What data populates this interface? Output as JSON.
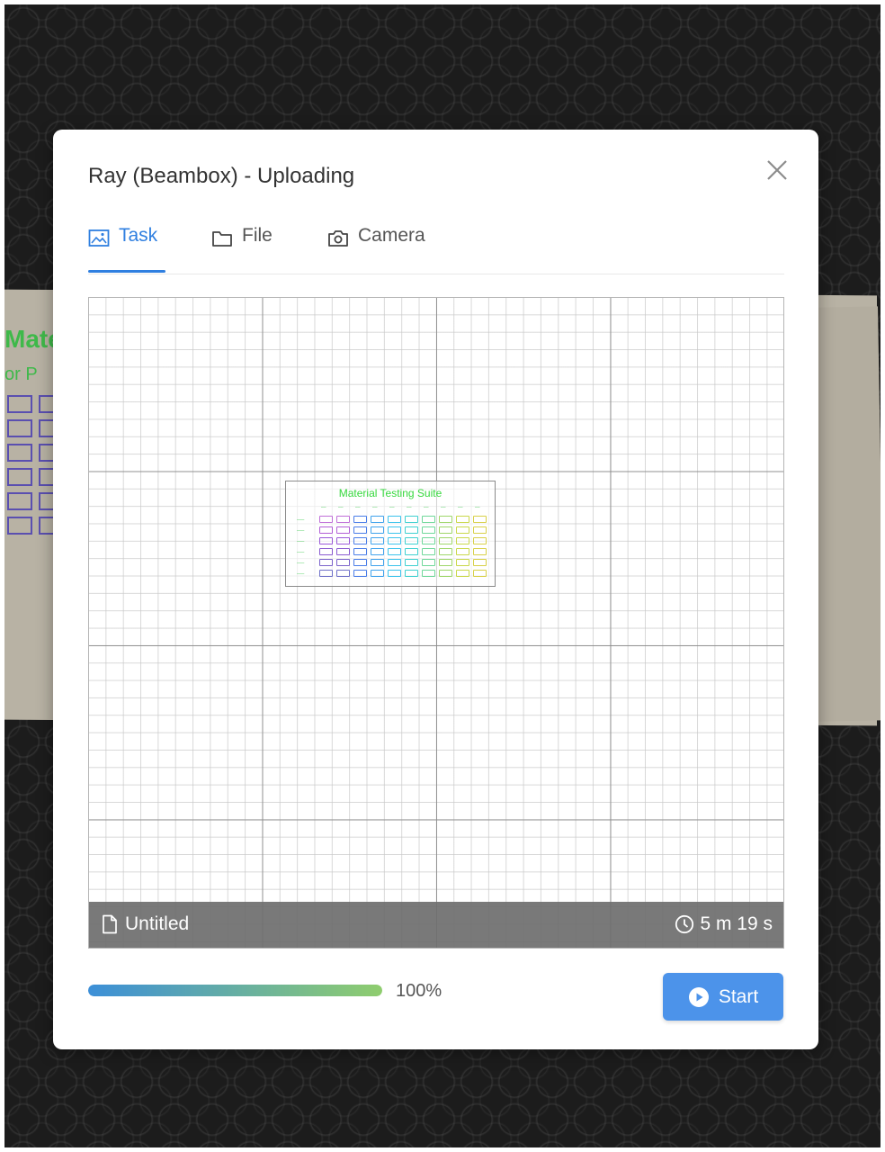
{
  "dialog": {
    "title": "Ray (Beambox) - Uploading",
    "close_icon": "close-icon"
  },
  "tabs": [
    {
      "label": "Task",
      "icon": "picture-icon",
      "active": true
    },
    {
      "label": "File",
      "icon": "folder-icon",
      "active": false
    },
    {
      "label": "Camera",
      "icon": "camera-icon",
      "active": false
    }
  ],
  "preview": {
    "artwork_title": "Material Testing Suite",
    "file_name": "Untitled",
    "file_icon": "file-icon",
    "duration": "5 m 19 s",
    "clock_icon": "clock-icon"
  },
  "progress": {
    "value": 1.0,
    "label": "100%"
  },
  "start_button": {
    "label": "Start",
    "icon": "play-circle-icon"
  },
  "colors": {
    "accent": "#2f7fe0",
    "button": "#4c93ea",
    "progress_start": "#3c8fd8",
    "progress_end": "#8fcd6e"
  }
}
